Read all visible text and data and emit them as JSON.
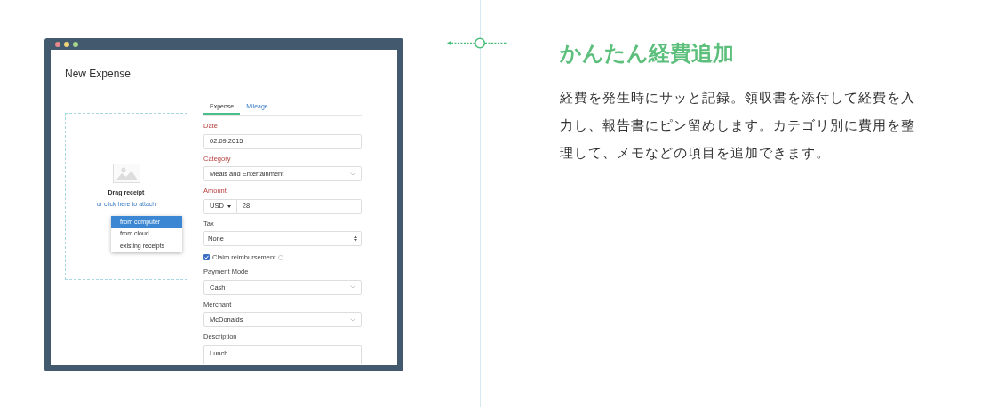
{
  "app_window": {
    "title": "New Expense",
    "dropzone": {
      "heading": "Drag receipt",
      "link": "or click here to attach",
      "menu": [
        {
          "label": "from computer",
          "selected": true
        },
        {
          "label": "from cloud",
          "selected": false
        },
        {
          "label": "existing receipts",
          "selected": false
        }
      ]
    },
    "tabs": [
      {
        "label": "Expense",
        "selected": true
      },
      {
        "label": "Mileage",
        "selected": false
      }
    ],
    "fields": [
      {
        "kind": "text",
        "label": "Date",
        "required": true,
        "value": "02.09.2015"
      },
      {
        "kind": "select",
        "label": "Category",
        "required": true,
        "value": "Meals and Entertainment"
      },
      {
        "kind": "amount",
        "label": "Amount",
        "required": true,
        "currency": "USD",
        "value": "28"
      },
      {
        "kind": "stepper",
        "label": "Tax",
        "required": false,
        "value": "None"
      },
      {
        "kind": "checkbox",
        "label": "Claim reimbursement",
        "checked": true
      },
      {
        "kind": "select",
        "label": "Payment Mode",
        "required": false,
        "value": "Cash"
      },
      {
        "kind": "select",
        "label": "Merchant",
        "required": false,
        "value": "McDonalds"
      },
      {
        "kind": "textarea",
        "label": "Description",
        "required": false,
        "value": "Lunch"
      }
    ]
  },
  "feature": {
    "title": "かんたん経費追加",
    "body": "経費を発生時にサッと記録。領収書を添付して経費を入力し、報告書にピン留めします。カテゴリ別に費用を整理して、メモなどの項目を追加できます。"
  }
}
